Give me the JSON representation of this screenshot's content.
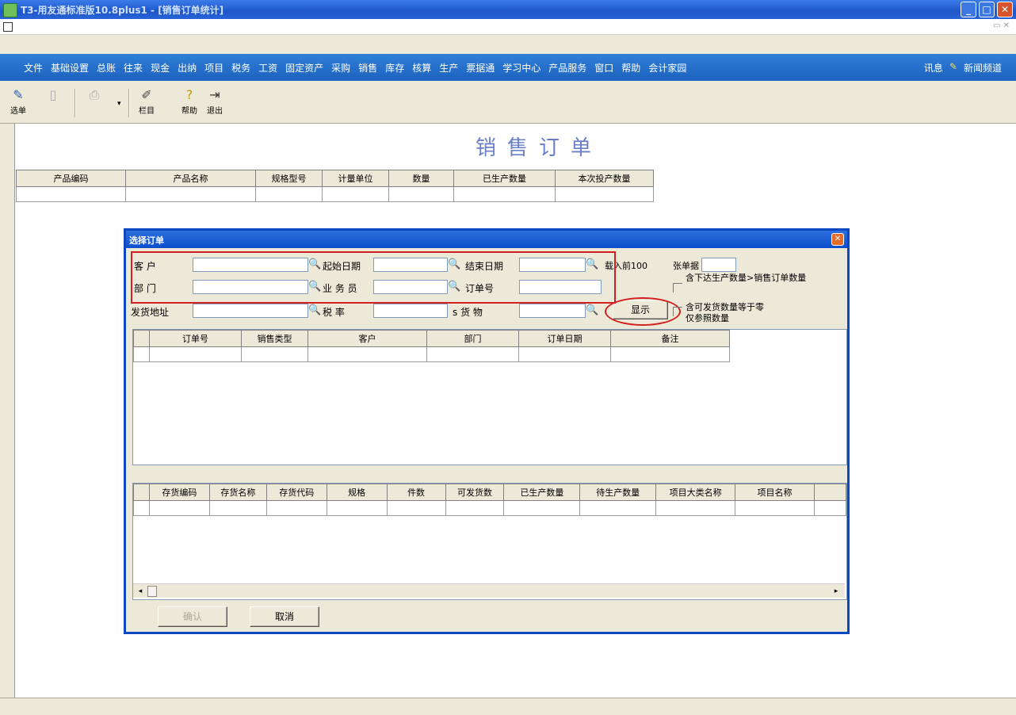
{
  "window": {
    "title": "T3-用友通标准版10.8plus1 - [销售订单统计]"
  },
  "menubar": {
    "items": [
      "文件",
      "基础设置",
      "总账",
      "往来",
      "现金",
      "出纳",
      "项目",
      "税务",
      "工资",
      "固定资产",
      "采购",
      "销售",
      "库存",
      "核算",
      "生产",
      "票据通",
      "学习中心",
      "产品服务",
      "窗口",
      "帮助",
      "会计家园"
    ],
    "right_items": [
      "讯息",
      "新闻频道"
    ]
  },
  "toolbar": {
    "buttons": [
      {
        "label": "选单",
        "icon": "select-icon"
      },
      {
        "label": "",
        "icon": "blank-doc-icon"
      },
      {
        "label": "",
        "icon": "print-icon"
      },
      {
        "label": "栏目",
        "icon": "column-icon"
      },
      {
        "label": "帮助",
        "icon": "help-icon"
      },
      {
        "label": "退出",
        "icon": "exit-icon"
      }
    ]
  },
  "document": {
    "title": "销售订单",
    "grid_headers": [
      "产品编码",
      "产品名称",
      "规格型号",
      "计量单位",
      "数量",
      "已生产数量",
      "本次投产数量"
    ]
  },
  "dialog": {
    "title": "选择订单",
    "fields": {
      "customer_label": "客  户",
      "start_date_label": "起始日期",
      "end_date_label": "结束日期",
      "department_label": "部  门",
      "salesman_label": "业 务 员",
      "order_no_label": "订单号",
      "ship_address_label": "发货地址",
      "rate_label": "税  率",
      "goods_label": "s 货  物"
    },
    "load_label": "载入前100",
    "single_count_label": "张单据",
    "check1_label": "含下达生产数量>销售订单数量",
    "check2_label": "含可发货数量等于零",
    "check2_label2": "仅参照数量",
    "show_button": "显示",
    "order_headers": [
      "订单号",
      "销售类型",
      "客户",
      "部门",
      "订单日期",
      "备注"
    ],
    "detail_headers": [
      "存货编码",
      "存货名称",
      "存货代码",
      "规格",
      "件数",
      "可发货数",
      "已生产数量",
      "待生产数量",
      "项目大类名称",
      "项目名称"
    ],
    "ok_button": "确认",
    "cancel_button": "取消"
  }
}
